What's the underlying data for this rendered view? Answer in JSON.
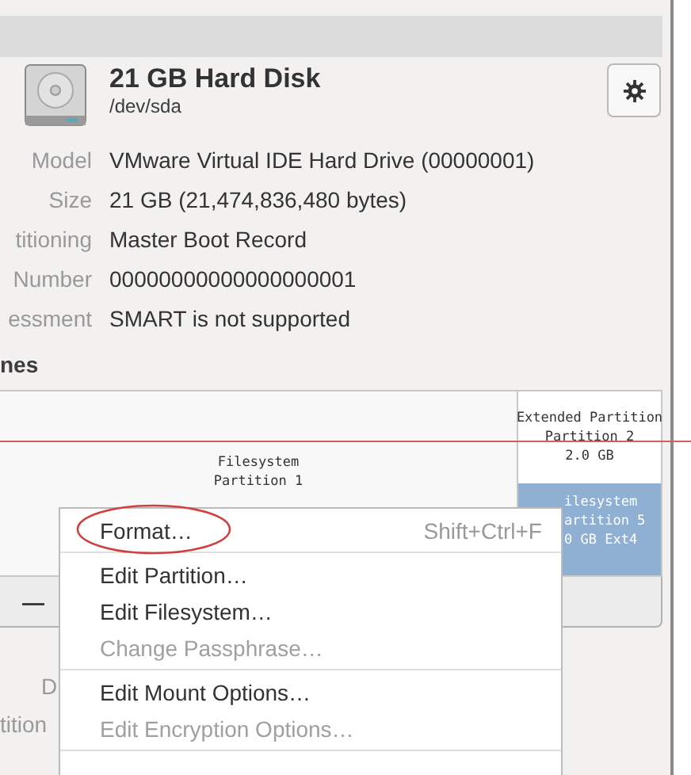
{
  "disk": {
    "title": "21 GB Hard Disk",
    "device": "/dev/sda"
  },
  "properties": [
    {
      "label": "Model",
      "value": "VMware Virtual IDE Hard Drive (00000001)"
    },
    {
      "label": "Size",
      "value": "21 GB (21,474,836,480 bytes)"
    },
    {
      "label": "titioning",
      "value": "Master Boot Record"
    },
    {
      "label": "Number",
      "value": "00000000000000000001"
    },
    {
      "label": "essment",
      "value": "SMART is not supported"
    }
  ],
  "section_heading": "nes",
  "partitions": [
    {
      "kind": "plain",
      "selected": false,
      "lines": [
        "Filesystem",
        "Partition 1"
      ]
    },
    {
      "kind": "extended",
      "selected": false,
      "lines": [
        "Extended Partition",
        "Partition 2",
        "2.0 GB"
      ],
      "children": [
        {
          "selected": true,
          "lines": [
            "ilesystem",
            "artition 5",
            "0 GB Ext4"
          ]
        }
      ]
    }
  ],
  "toolbar": {
    "remove_button": "—"
  },
  "lower_labels": [
    "D",
    "tition"
  ],
  "context_menu": [
    {
      "kind": "item",
      "label": "Format…",
      "shortcut": "Shift+Ctrl+F",
      "disabled": false,
      "circled": true
    },
    {
      "kind": "separator"
    },
    {
      "kind": "item",
      "label": "Edit Partition…",
      "disabled": false,
      "circled": false
    },
    {
      "kind": "item",
      "label": "Edit Filesystem…",
      "disabled": false,
      "circled": false
    },
    {
      "kind": "item",
      "label": "Change Passphrase…",
      "disabled": true,
      "circled": false
    },
    {
      "kind": "separator"
    },
    {
      "kind": "item",
      "label": "Edit Mount Options…",
      "disabled": false,
      "circled": false
    },
    {
      "kind": "item",
      "label": "Edit Encryption Options…",
      "disabled": true,
      "circled": false
    },
    {
      "kind": "separator"
    }
  ]
}
